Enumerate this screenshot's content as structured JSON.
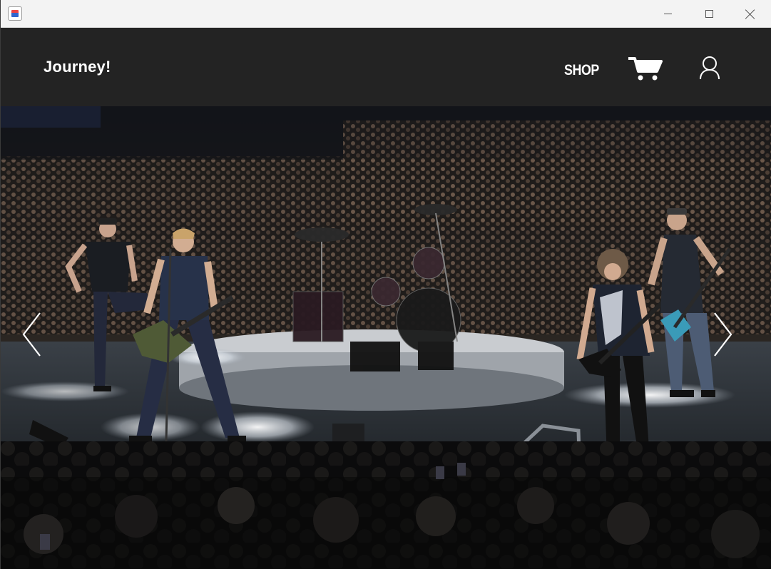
{
  "window": {
    "icon": "java-app-icon",
    "controls": [
      "minimize-icon",
      "maximize-icon",
      "close-icon"
    ]
  },
  "header": {
    "brand": "Journey!",
    "nav": {
      "shop_label": "SHOP",
      "cart_icon": "cart-icon",
      "user_icon": "user-icon"
    },
    "background": "#232323"
  },
  "hero": {
    "image": "concert-band-on-stage-photo",
    "prev_icon": "chevron-left-icon",
    "next_icon": "chevron-right-icon"
  }
}
